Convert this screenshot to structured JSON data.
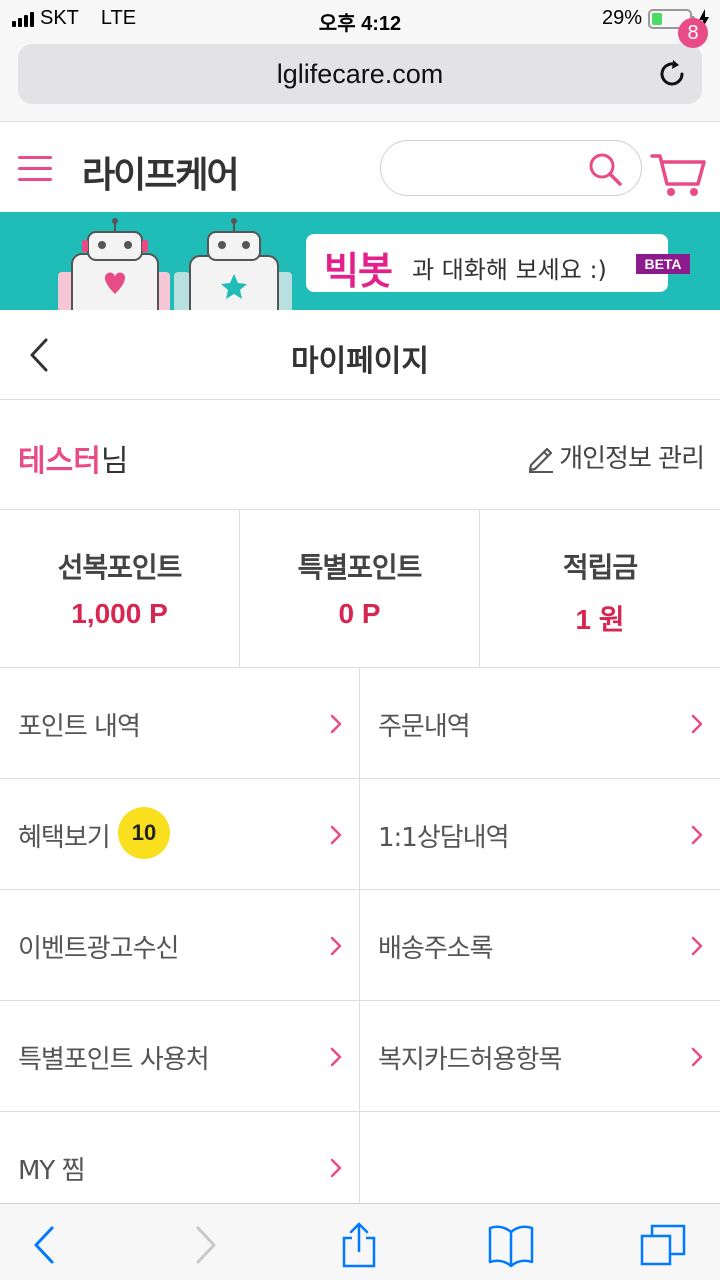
{
  "status_bar": {
    "carrier": "SKT",
    "network": "LTE",
    "time": "오후 4:12",
    "battery": "29%",
    "battery_level": 0.29
  },
  "browser": {
    "url": "lglifecare.com"
  },
  "header": {
    "logo": "라이프케어",
    "search_placeholder": "",
    "cart_count": "8"
  },
  "banner": {
    "highlight": "빅봇",
    "text": "과 대화해 보세요 :)",
    "tag": "BETA"
  },
  "page": {
    "title": "마이페이지"
  },
  "user": {
    "name": "테스터",
    "suffix": "님",
    "profile_link": "개인정보 관리"
  },
  "points": [
    {
      "label": "선복포인트",
      "value": "1,000 P"
    },
    {
      "label": "특별포인트",
      "value": "0 P"
    },
    {
      "label": "적립금",
      "value": "1 원"
    }
  ],
  "menu": [
    {
      "label": "포인트 내역"
    },
    {
      "label": "주문내역"
    },
    {
      "label": "혜택보기",
      "badge": "10"
    },
    {
      "label": "1:1상담내역"
    },
    {
      "label": "이벤트광고수신"
    },
    {
      "label": "배송주소록"
    },
    {
      "label": "특별포인트 사용처"
    },
    {
      "label": "복지카드허용항목"
    },
    {
      "label": "MY 찜"
    }
  ],
  "colors": {
    "brand_pink": "#e94b87",
    "point_red": "#d7264f",
    "banner_teal": "#20bcb8",
    "badge_yellow": "#f9df1e",
    "ios_blue": "#007aff"
  }
}
